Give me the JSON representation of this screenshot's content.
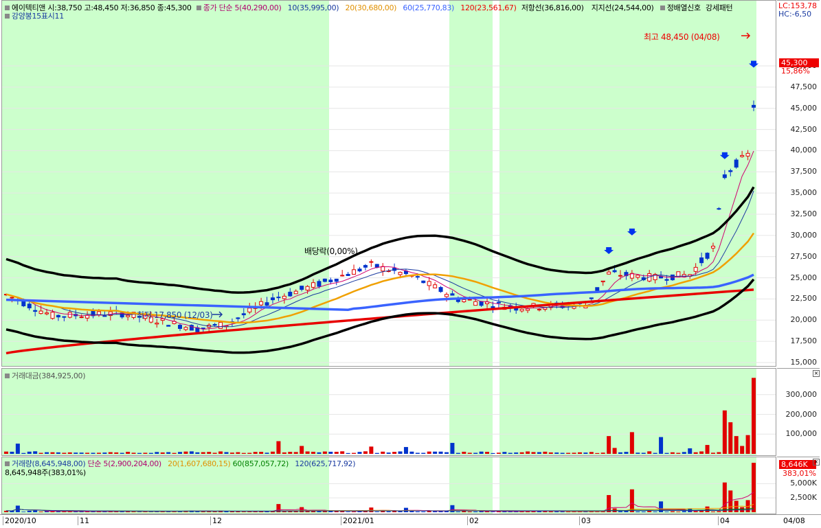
{
  "legend_top": {
    "name": "에이텍티앤",
    "ohlc": "시:38,750 고:48,450 저:36,850 종:45,300",
    "ma_title": "종가 단순",
    "ma5": "5(40,290,00)",
    "ma10": "10(35,995,00)",
    "ma20": "20(30,680,00)",
    "ma60": "60(25,770,83)",
    "ma120": "120(23,561,67)",
    "resist": "저항선(36,816,00)",
    "support": "지지선(24,544,00)",
    "signal1": "정배열신호",
    "signal2": "강세패턴",
    "line2": "강양봉15표시11"
  },
  "price_ticks": [
    "50,000",
    "47,500",
    "45,000",
    "42,500",
    "40,000",
    "37,500",
    "35,000",
    "32,500",
    "30,000",
    "27,500",
    "25,000",
    "22,500",
    "20,000",
    "17,500",
    "15,000"
  ],
  "price_badges": {
    "current": "45,300",
    "pct": "15,86%",
    "lc": "LC:153,78",
    "hc": "HC:-6,50"
  },
  "annotations": {
    "high": "최고 48,450 (04/08)",
    "low": "최저 17,850 (12/03)",
    "dividend": "배당락(0,00%)"
  },
  "amount_panel": {
    "title": "거래대금(384,925,00)",
    "ticks": [
      "300,000",
      "200,000",
      "100,000"
    ]
  },
  "volume_panel": {
    "title_a": "거래량(8,645,948,00)",
    "title_b": "단순 5(2,900,204,00)",
    "title_c": "20(1,607,680,15)",
    "title_d": "60(857,057,72)",
    "title_e": "120(625,717,92)",
    "line2": "8,645,948주(383,01%)",
    "ticks": [
      "5,000K",
      "2,500K"
    ],
    "badge": "8,646K",
    "badge_pct": "383,01%"
  },
  "x_labels": [
    "2020/10",
    "11",
    "12",
    "2021/01",
    "02",
    "03",
    "04"
  ],
  "x_label_right": "04/08",
  "colors": {
    "up": "#e00000",
    "down": "#0033cc",
    "shade": "#ccffcc",
    "ma5": "#d0006f",
    "ma20": "#f0a000",
    "ma60": "#3a63ff",
    "ma120": "#e80000",
    "envelope": "#000000"
  }
}
